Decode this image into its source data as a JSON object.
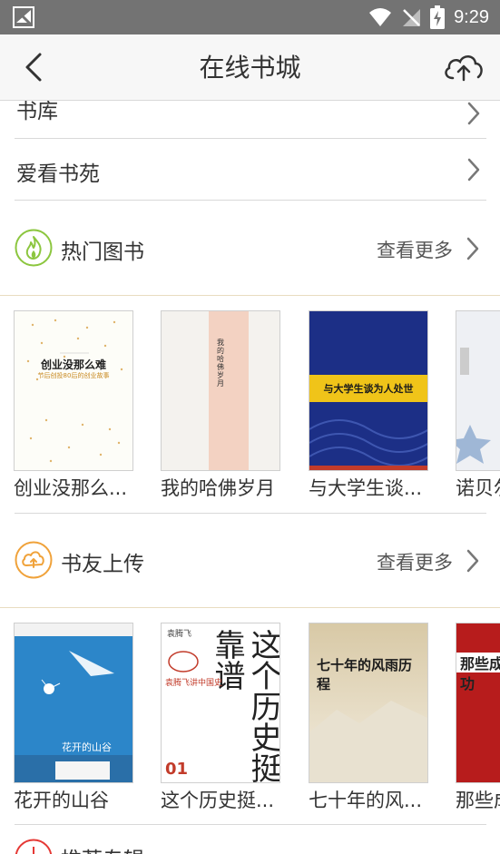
{
  "status": {
    "time": "9:29"
  },
  "header": {
    "title": "在线书城"
  },
  "menu": [
    {
      "label": "书库"
    },
    {
      "label": "爱看书苑"
    }
  ],
  "sections": [
    {
      "title": "热门图书",
      "more": "查看更多",
      "books": [
        {
          "title": "创业没那么...",
          "cover_main": "创业没那么难",
          "cover_sub": "节后创投80后的创业故事"
        },
        {
          "title": "我的哈佛岁月",
          "cover_main": "我的哈佛岁月"
        },
        {
          "title": "与大学生谈...",
          "cover_main": "与大学生谈为人处世"
        },
        {
          "title": "诺贝尔"
        }
      ]
    },
    {
      "title": "书友上传",
      "more": "查看更多",
      "books": [
        {
          "title": "花开的山谷",
          "cover_main": "花开的山谷"
        },
        {
          "title": "这个历史挺...",
          "cover_main": "这个历史挺靠谱",
          "cover_author": "袁腾飞",
          "cover_sub": "袁腾飞讲中国史",
          "cover_num": "01"
        },
        {
          "title": "七十年的风...",
          "cover_main": "七十年的风雨历程"
        },
        {
          "title": "那些成",
          "cover_main": "那些成功"
        }
      ]
    },
    {
      "title": "推荐专辑"
    }
  ]
}
